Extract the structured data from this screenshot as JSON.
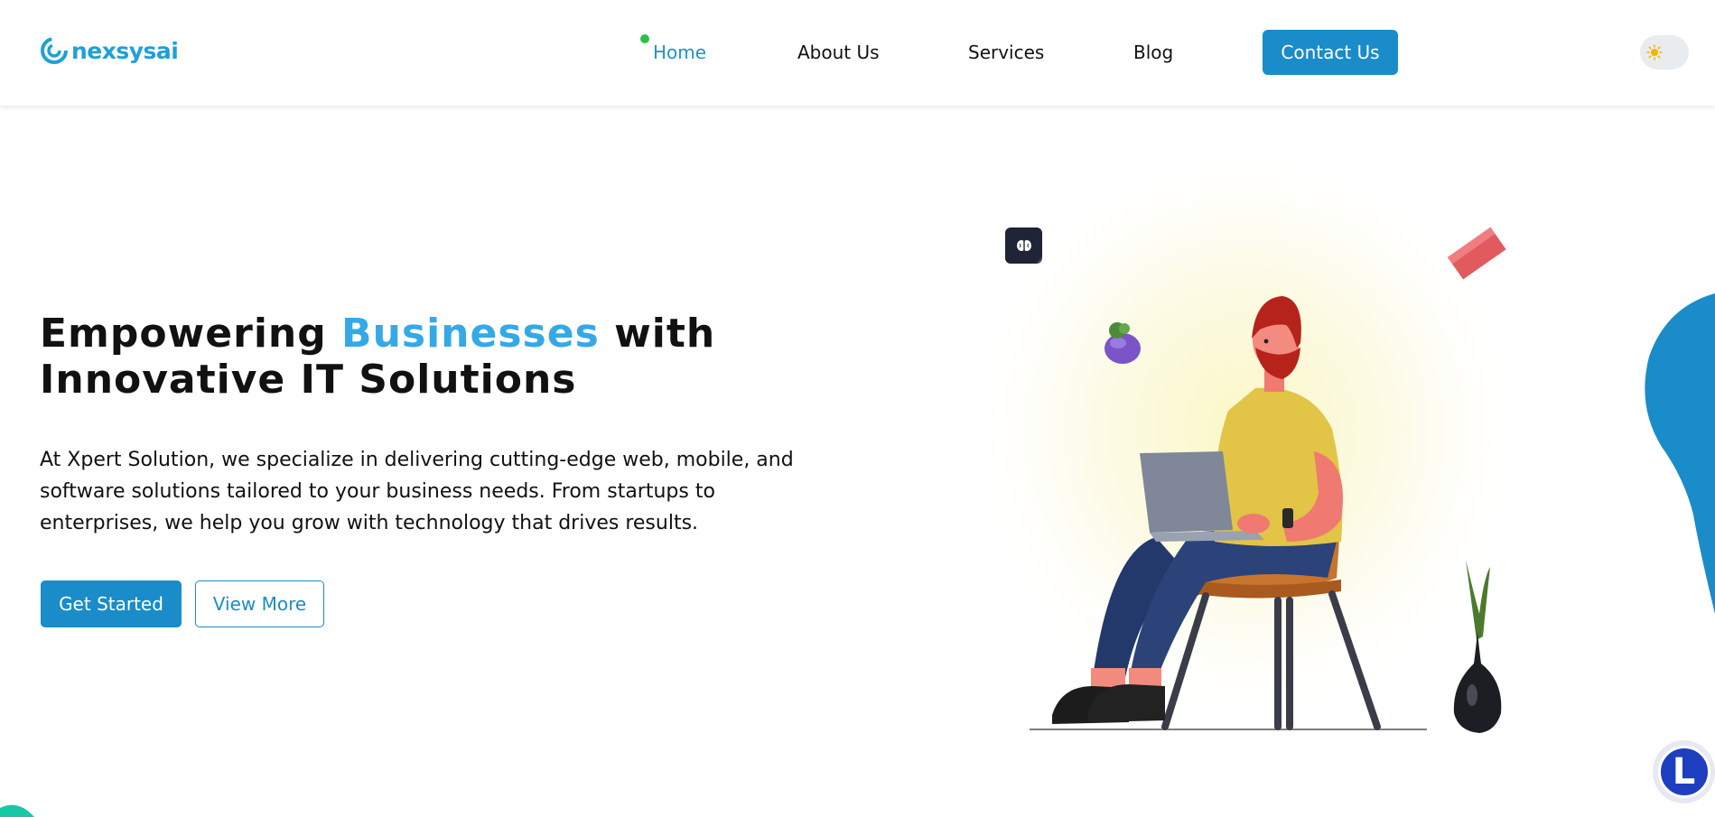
{
  "brand": {
    "name": "nexsysai",
    "color": "#1fa0d8"
  },
  "nav": {
    "items": [
      {
        "label": "Home",
        "active": true
      },
      {
        "label": "About Us",
        "active": false
      },
      {
        "label": "Services",
        "active": false
      },
      {
        "label": "Blog",
        "active": false
      }
    ],
    "contact_label": "Contact Us",
    "theme_toggle_icon": "sun-icon"
  },
  "hero": {
    "title_before": "Empowering ",
    "title_accent": "Businesses",
    "title_after": " with",
    "title_line2": "Innovative IT Solutions",
    "description": "At Xpert Solution, we specialize in delivering cutting-edge web, mobile, and software solutions tailored to your business needs. From startups to enterprises, we help you grow with technology that drives results.",
    "primary_button": "Get Started",
    "secondary_button": "View More"
  },
  "chat_widget": {
    "letter": "L"
  },
  "colors": {
    "accent": "#1a8cc9",
    "title_accent": "#35a9e6",
    "active_dot": "#2dbf4a"
  }
}
